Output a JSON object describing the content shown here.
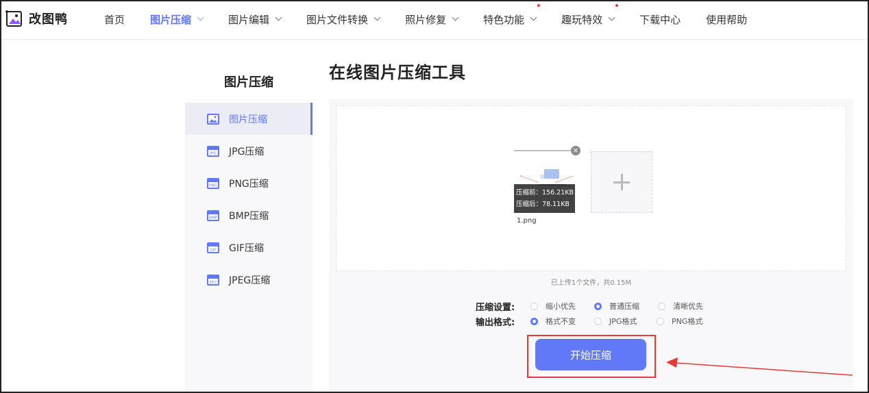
{
  "header": {
    "brand": "改图鸭",
    "nav": [
      {
        "label": "首页",
        "dropdown": false,
        "hot": false,
        "active": false
      },
      {
        "label": "图片压缩",
        "dropdown": true,
        "hot": false,
        "active": true
      },
      {
        "label": "图片编辑",
        "dropdown": true,
        "hot": false,
        "active": false
      },
      {
        "label": "图片文件转换",
        "dropdown": true,
        "hot": false,
        "active": false
      },
      {
        "label": "照片修复",
        "dropdown": true,
        "hot": false,
        "active": false
      },
      {
        "label": "特色功能",
        "dropdown": true,
        "hot": true,
        "active": false
      },
      {
        "label": "趣玩特效",
        "dropdown": true,
        "hot": true,
        "active": false
      },
      {
        "label": "下载中心",
        "dropdown": false,
        "hot": false,
        "active": false
      },
      {
        "label": "使用帮助",
        "dropdown": false,
        "hot": false,
        "active": false
      }
    ]
  },
  "sidebar": {
    "title": "图片压缩",
    "items": [
      {
        "label": "图片压缩",
        "icon": "image-icon",
        "tag": "",
        "active": true
      },
      {
        "label": "JPG压缩",
        "icon": "jpg-file-icon",
        "tag": "JPG",
        "active": false
      },
      {
        "label": "PNG压缩",
        "icon": "png-file-icon",
        "tag": "PNG",
        "active": false
      },
      {
        "label": "BMP压缩",
        "icon": "bmp-file-icon",
        "tag": "BMP",
        "active": false
      },
      {
        "label": "GIF压缩",
        "icon": "gif-file-icon",
        "tag": "GIF",
        "active": false
      },
      {
        "label": "JPEG压缩",
        "icon": "jpeg-file-icon",
        "tag": "JPEG",
        "active": false
      }
    ]
  },
  "main": {
    "title": "在线图片压缩工具",
    "file": {
      "before": "压缩前：156.21KB",
      "after": "压缩后：78.11KB",
      "name": "1.png"
    },
    "upload_info": "已上传1个文件，共0.15M",
    "compress_setting": {
      "label": "压缩设置:",
      "options": [
        "缩小优先",
        "普通压缩",
        "清晰优先"
      ],
      "selected": "普通压缩"
    },
    "output_format": {
      "label": "输出格式:",
      "options": [
        "格式不变",
        "JPG格式",
        "PNG格式"
      ],
      "selected": "格式不变"
    },
    "start_button": "开始压缩"
  },
  "colors": {
    "accent": "#6079f7",
    "hot_dot": "#f5353b",
    "annotation": "#e53935"
  }
}
